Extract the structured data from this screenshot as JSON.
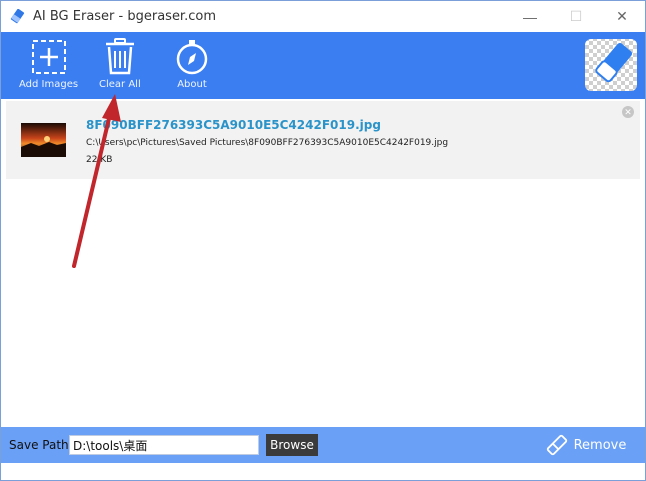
{
  "window": {
    "title": "AI BG Eraser - bgeraser.com"
  },
  "toolbar": {
    "add_images": "Add Images",
    "clear_all": "Clear All",
    "about": "About"
  },
  "file": {
    "name": "8F090BFF276393C5A9010E5C4242F019.jpg",
    "path": "C:\\Users\\pc\\Pictures\\Saved Pictures\\8F090BFF276393C5A9010E5C4242F019.jpg",
    "size": "22 KB"
  },
  "bottom": {
    "save_path_label": "Save Path",
    "save_path_value": "D:\\tools\\桌面",
    "browse_label": "Browse",
    "remove_label": "Remove"
  },
  "colors": {
    "toolbar": "#3a7ef2",
    "bottombar": "#6aa0f5",
    "file_name": "#2a93c9",
    "annotation": "#c0262b"
  }
}
